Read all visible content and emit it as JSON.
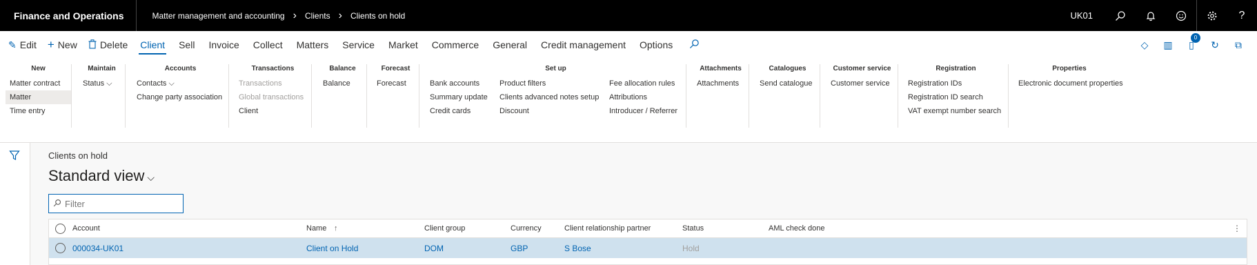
{
  "app": {
    "title": "Finance and Operations"
  },
  "breadcrumb": [
    "Matter management and accounting",
    "Clients",
    "Clients on hold"
  ],
  "topbar": {
    "company": "UK01"
  },
  "actions": {
    "edit": "Edit",
    "new": "New",
    "delete": "Delete"
  },
  "tabs": [
    "Client",
    "Sell",
    "Invoice",
    "Collect",
    "Matters",
    "Service",
    "Market",
    "Commerce",
    "General",
    "Credit management",
    "Options"
  ],
  "notification_badge": "0",
  "ribbon": {
    "new": {
      "title": "New",
      "items": [
        "Matter contract",
        "Matter",
        "Time entry"
      ]
    },
    "maintain": {
      "title": "Maintain",
      "items": [
        "Status"
      ]
    },
    "accounts": {
      "title": "Accounts",
      "items": [
        "Contacts",
        "Change party association"
      ]
    },
    "transactions": {
      "title": "Transactions",
      "items": [
        "Transactions",
        "Global transactions",
        "Client"
      ]
    },
    "balance": {
      "title": "Balance",
      "items": [
        "Balance"
      ]
    },
    "forecast": {
      "title": "Forecast",
      "items": [
        "Forecast"
      ]
    },
    "setup": {
      "title": "Set up",
      "col1": [
        "Bank accounts",
        "Summary update",
        "Credit cards"
      ],
      "col2": [
        "Product filters",
        "Clients advanced notes setup",
        "Discount"
      ],
      "col3": [
        "Fee allocation rules",
        "Attributions",
        "Introducer / Referrer"
      ]
    },
    "attachments": {
      "title": "Attachments",
      "items": [
        "Attachments"
      ]
    },
    "catalogues": {
      "title": "Catalogues",
      "items": [
        "Send catalogue"
      ]
    },
    "customer_service": {
      "title": "Customer service",
      "items": [
        "Customer service"
      ]
    },
    "registration": {
      "title": "Registration",
      "items": [
        "Registration IDs",
        "Registration ID search",
        "VAT exempt number search"
      ]
    },
    "properties": {
      "title": "Properties",
      "items": [
        "Electronic document properties"
      ]
    }
  },
  "page": {
    "caption": "Clients on hold",
    "view": "Standard view",
    "filter_placeholder": "Filter"
  },
  "grid": {
    "columns": [
      "Account",
      "Name",
      "Client group",
      "Currency",
      "Client relationship partner",
      "Status",
      "AML check done"
    ],
    "rows": [
      {
        "account": "000034-UK01",
        "name": "Client on Hold",
        "group": "DOM",
        "currency": "GBP",
        "partner": "S Bose",
        "status": "Hold",
        "aml": ""
      }
    ]
  }
}
